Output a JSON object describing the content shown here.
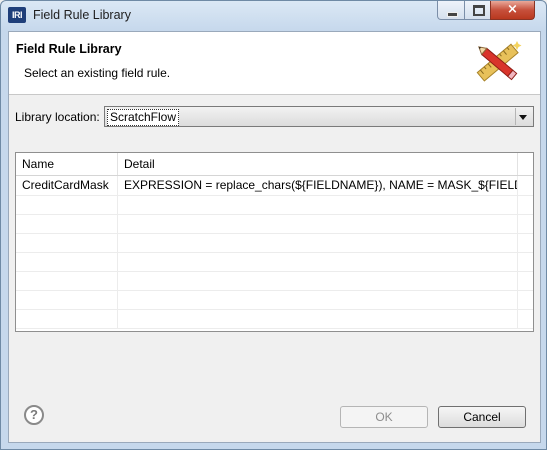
{
  "window": {
    "title": "Field Rule Library",
    "app_icon_text": "IRI",
    "close_glyph": "×"
  },
  "header": {
    "title": "Field Rule Library",
    "message": "Select an existing field rule.",
    "icon": "pencil-ruler-wizard-icon"
  },
  "library": {
    "label": "Library location:",
    "selected": "ScratchFlow"
  },
  "table": {
    "columns": [
      "Name",
      "Detail"
    ],
    "rows": [
      {
        "name": "CreditCardMask",
        "detail": "EXPRESSION = replace_chars(${FIELDNAME}), NAME = MASK_${FIELDN..."
      }
    ]
  },
  "footer": {
    "help_glyph": "?",
    "ok_label": "OK",
    "cancel_label": "Cancel",
    "ok_enabled": false
  }
}
